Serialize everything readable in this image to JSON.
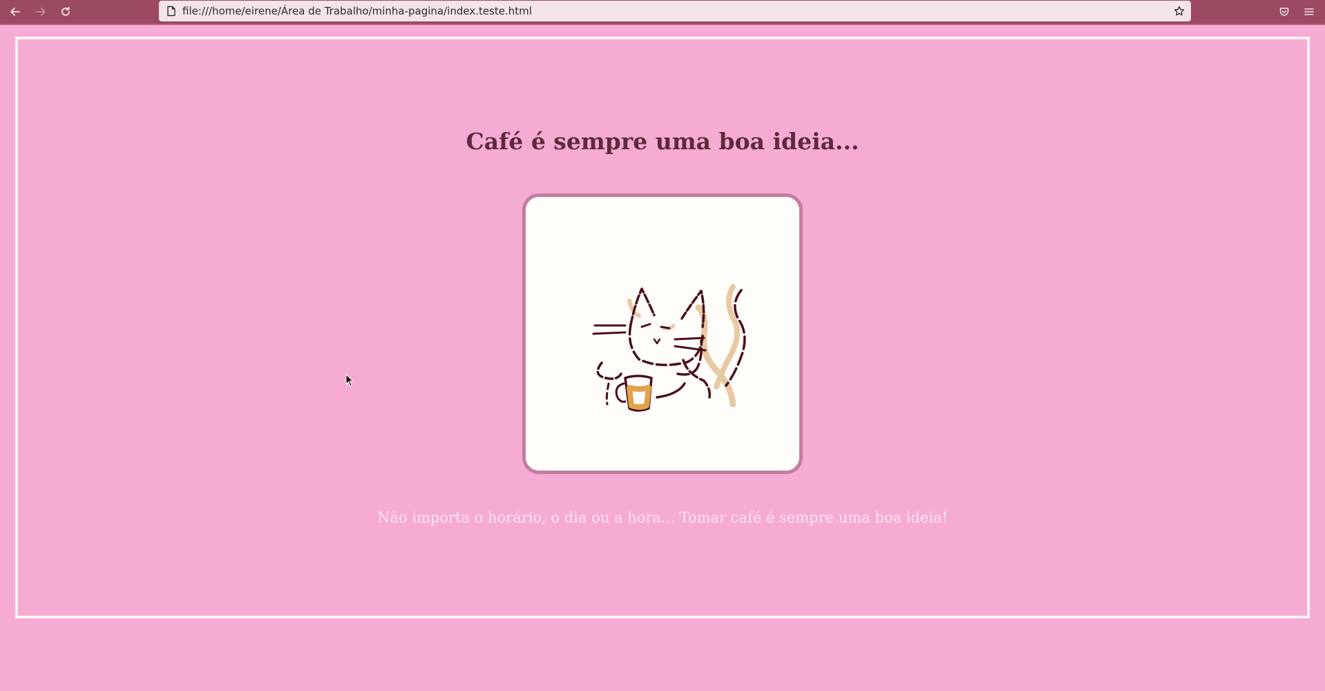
{
  "browser": {
    "url": "file:///home/eirene/Área de Trabalho/minha-pagina/index.teste.html",
    "back_icon": "arrow-left-icon",
    "forward_icon": "arrow-right-icon",
    "reload_icon": "reload-icon",
    "bookmark_icon": "star-icon",
    "pocket_icon": "pocket-icon",
    "menu_icon": "hamburger-menu-icon"
  },
  "page": {
    "title": "Café é sempre uma boa ideia...",
    "image_alt": "gato tomando café",
    "caption": "Não importa o horário, o dia ou a hora... Tomar café é sempre uma boa ideia!"
  },
  "colors": {
    "background": "#f6abd3",
    "toolbar": "#9b4a61",
    "title": "#5c2a3c",
    "card_border": "#c27d9f",
    "caption": "#fbe6ef"
  }
}
